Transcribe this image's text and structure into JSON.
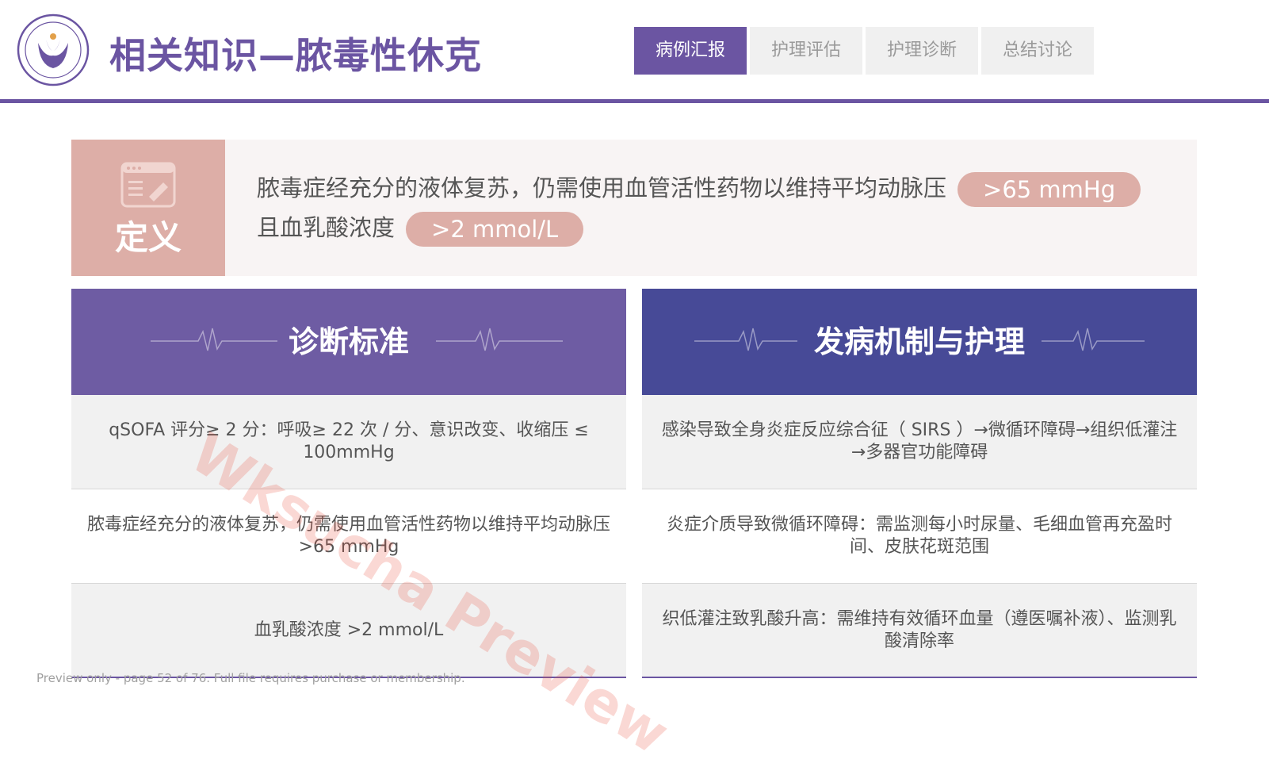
{
  "header": {
    "title": "相关知识—脓毒性休克",
    "tabs": [
      {
        "label": "病例汇报",
        "active": true
      },
      {
        "label": "护理评估",
        "active": false
      },
      {
        "label": "护理诊断",
        "active": false
      },
      {
        "label": "总结讨论",
        "active": false
      }
    ]
  },
  "definition": {
    "label": "定义",
    "line1": "脓毒症经充分的液体复苏，仍需使用血管活性药物以维持平均动脉压",
    "pill1": ">65 mmHg",
    "line2": "且血乳酸浓度",
    "pill2": ">2 mmol/L"
  },
  "diagnosis": {
    "title": "诊断标准",
    "rows": [
      "qSOFA 评分≥ 2 分：呼吸≥ 22 次 / 分、意识改变、收缩压 ≤ 100mmHg",
      "脓毒症经充分的液体复苏，仍需使用血管活性药物以维持平均动脉压 >65 mmHg",
      "血乳酸浓度 >2 mmol/L"
    ]
  },
  "mechanism": {
    "title": "发病机制与护理",
    "rows": [
      "感染导致全身炎症反应综合征（ SIRS ）→微循环障碍→组织低灌注→多器官功能障碍",
      "炎症介质导致微循环障碍：需监测每小时尿量、毛细血管再充盈时间、皮肤花斑范围",
      "织低灌注致乳酸升高：需维持有效循环血量（遵医嘱补液）、监测乳酸清除率"
    ]
  },
  "watermark": "Wksucha Preview",
  "footer": "Preview only - page 52 of 76. Full file requires purchase or membership.",
  "colors": {
    "brand": "#6b55a2",
    "header_left": "#6e5ca3",
    "header_right": "#474a97",
    "pink": "#ddaea7"
  }
}
